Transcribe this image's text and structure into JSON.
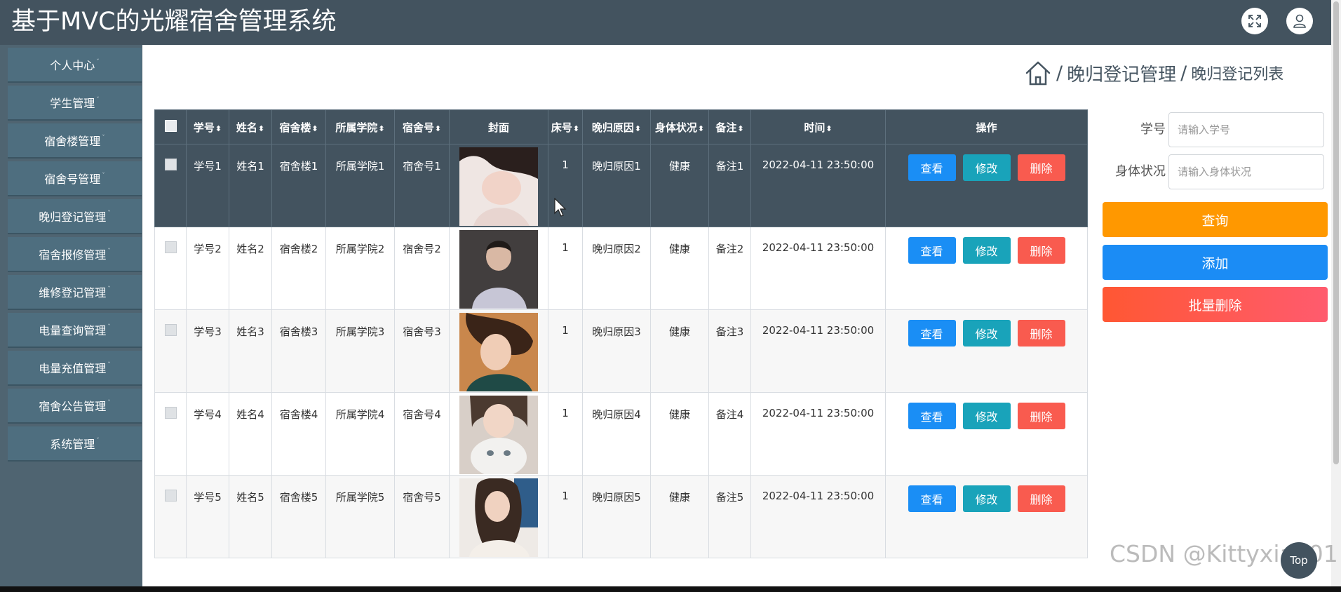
{
  "app": {
    "title": "基于MVC的光耀宿舍管理系统"
  },
  "header": {
    "fullscreen_icon": "expand-icon",
    "user_icon": "user-icon"
  },
  "sidebar": {
    "items": [
      {
        "label": "个人中心"
      },
      {
        "label": "学生管理"
      },
      {
        "label": "宿舍楼管理"
      },
      {
        "label": "宿舍号管理"
      },
      {
        "label": "晚归登记管理"
      },
      {
        "label": "宿舍报修管理"
      },
      {
        "label": "维修登记管理"
      },
      {
        "label": "电量查询管理"
      },
      {
        "label": "电量充值管理"
      },
      {
        "label": "宿舍公告管理"
      },
      {
        "label": "系统管理"
      }
    ],
    "caret": "ˇ"
  },
  "breadcrumb": {
    "separator": "/",
    "section": "晚归登记管理",
    "page": "晚归登记列表",
    "home_icon": "home-icon"
  },
  "table": {
    "sort_icon": "⬍",
    "columns": {
      "student_no": "学号",
      "name": "姓名",
      "building": "宿舍楼",
      "college": "所属学院",
      "room": "宿舍号",
      "cover": "封面",
      "bed": "床号",
      "reason": "晚归原因",
      "health": "身体状况",
      "note": "备注",
      "time": "时间",
      "ops": "操作"
    },
    "rows": [
      {
        "student_no": "学号1",
        "name": "姓名1",
        "building": "宿舍楼1",
        "college": "所属学院1",
        "room": "宿舍号1",
        "bed": "1",
        "reason": "晚归原因1",
        "health": "健康",
        "note": "备注1",
        "time": "2022-04-11 23:50:00"
      },
      {
        "student_no": "学号2",
        "name": "姓名2",
        "building": "宿舍楼2",
        "college": "所属学院2",
        "room": "宿舍号2",
        "bed": "1",
        "reason": "晚归原因2",
        "health": "健康",
        "note": "备注2",
        "time": "2022-04-11 23:50:00"
      },
      {
        "student_no": "学号3",
        "name": "姓名3",
        "building": "宿舍楼3",
        "college": "所属学院3",
        "room": "宿舍号3",
        "bed": "1",
        "reason": "晚归原因3",
        "health": "健康",
        "note": "备注3",
        "time": "2022-04-11 23:50:00"
      },
      {
        "student_no": "学号4",
        "name": "姓名4",
        "building": "宿舍楼4",
        "college": "所属学院4",
        "room": "宿舍号4",
        "bed": "1",
        "reason": "晚归原因4",
        "health": "健康",
        "note": "备注4",
        "time": "2022-04-11 23:50:00"
      },
      {
        "student_no": "学号5",
        "name": "姓名5",
        "building": "宿舍楼5",
        "college": "所属学院5",
        "room": "宿舍号5",
        "bed": "1",
        "reason": "晚归原因5",
        "health": "健康",
        "note": "备注5",
        "time": "2022-04-11 23:50:00"
      }
    ],
    "actions": {
      "view": "查看",
      "edit": "修改",
      "delete": "删除"
    }
  },
  "search": {
    "student_no_label": "学号",
    "student_no_placeholder": "请输入学号",
    "health_label": "身体状况",
    "health_placeholder": "请输入身体状况",
    "query_button": "查询",
    "add_button": "添加",
    "batch_delete_button": "批量删除"
  },
  "back_to_top": "Top",
  "watermark": "CSDN @Kittyxia001",
  "colors": {
    "header_bg": "#43535f",
    "sidebar_bg": "#4f6471",
    "view_button": "#1a8ef5",
    "edit_button": "#19a3ba",
    "delete_button": "#f95b4f",
    "query_button": "#ff9800",
    "add_button": "#1b8cf5",
    "batch_delete_button": "#ff5a4f"
  }
}
